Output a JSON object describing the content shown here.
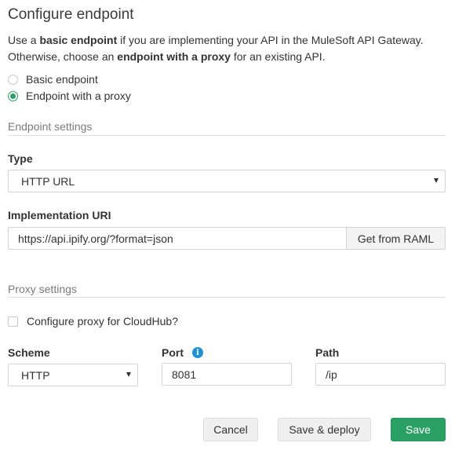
{
  "dialog": {
    "title": "Configure endpoint",
    "description": {
      "part1": "Use a ",
      "bold1": "basic endpoint",
      "part2": " if you are implementing your API in the MuleSoft API Gateway. Otherwise, choose an ",
      "bold2": "endpoint with a proxy",
      "part3": " for an existing API."
    },
    "options": [
      {
        "label": "Basic endpoint",
        "selected": false
      },
      {
        "label": "Endpoint with a proxy",
        "selected": true
      }
    ]
  },
  "endpoint_settings": {
    "section_title": "Endpoint settings",
    "type_label": "Type",
    "type_value": "HTTP URL",
    "uri_label": "Implementation URI",
    "uri_value": "https://api.ipify.org/?format=json",
    "raml_button": "Get from RAML"
  },
  "proxy_settings": {
    "section_title": "Proxy settings",
    "cloudhub_label": "Configure proxy for CloudHub?",
    "cloudhub_checked": false,
    "scheme_label": "Scheme",
    "scheme_value": "HTTP",
    "port_label": "Port",
    "port_info_icon": "info-icon",
    "port_value": "8081",
    "path_label": "Path",
    "path_value": "/ip"
  },
  "footer": {
    "cancel_label": "Cancel",
    "save_deploy_label": "Save & deploy",
    "save_label": "Save"
  },
  "colors": {
    "accent_green": "#2aa065",
    "info_blue": "#1e90d6"
  }
}
